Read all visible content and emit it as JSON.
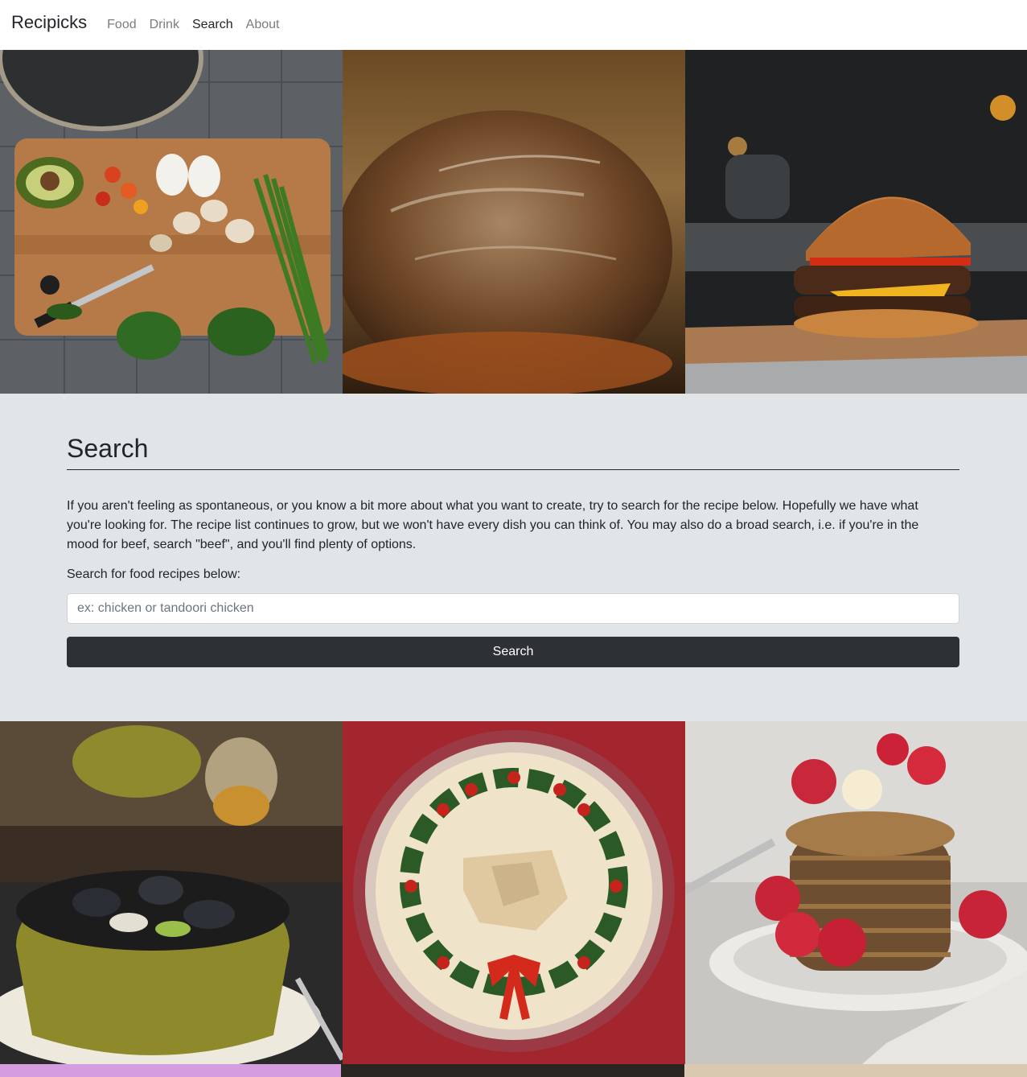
{
  "navbar": {
    "brand": "Recipicks",
    "links": [
      {
        "label": "Food",
        "active": false
      },
      {
        "label": "Drink",
        "active": false
      },
      {
        "label": "Search",
        "active": true
      },
      {
        "label": "About",
        "active": false
      }
    ]
  },
  "top_images": [
    {
      "icon": "cutting-board-ingredients-photo"
    },
    {
      "icon": "bread-loaf-photo"
    },
    {
      "icon": "burger-photo"
    }
  ],
  "search": {
    "title": "Search",
    "intro": "If you aren't feeling as spontaneous, or you know a bit more about what you want to create, try to search for the recipe below. Hopefully we have what you're looking for. The recipe list continues to grow, but we won't have every dish you can think of. You may also do a broad search, i.e. if you're in the mood for beef, search \"beef\", and you'll find plenty of options.",
    "prompt": "Search for food recipes below:",
    "placeholder": "ex: chicken or tandoori chicken",
    "value": "",
    "button_label": "Search"
  },
  "bottom_images": [
    {
      "icon": "mussels-pot-photo"
    },
    {
      "icon": "holiday-wreath-dip-photo"
    },
    {
      "icon": "pancakes-raspberries-photo"
    }
  ],
  "colors": {
    "section_bg": "#e2e5e8",
    "button_bg": "#2d3035",
    "nav_inactive": "#7a7d80"
  }
}
